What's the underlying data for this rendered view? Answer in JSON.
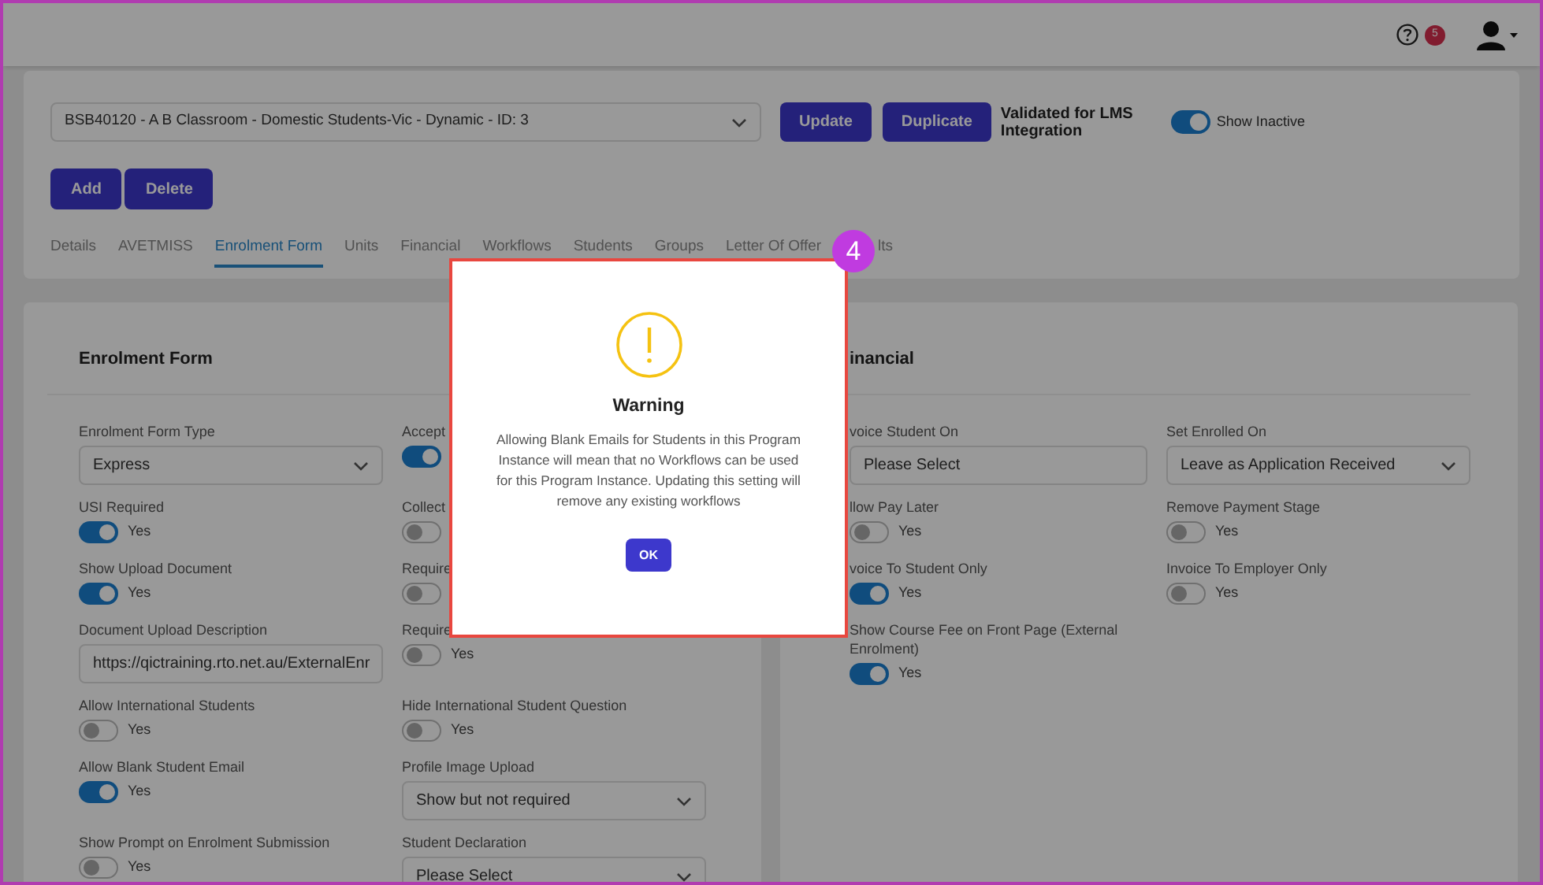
{
  "top_bar": {
    "notification_count": "5"
  },
  "program": {
    "selection": "BSB40120 - A B Classroom - Domestic Students-Vic - Dynamic - ID: 3",
    "buttons": [
      "Update",
      "Duplicate"
    ],
    "validation_note": "Validated for LMS Integration",
    "show_inactive": {
      "label": "Show Inactive",
      "on": true
    }
  },
  "actions": [
    "Add",
    "Delete"
  ],
  "tabs": [
    {
      "label": "Details",
      "selected": false
    },
    {
      "label": "AVETMISS",
      "selected": false
    },
    {
      "label": "Enrolment Form",
      "selected": true
    },
    {
      "label": "Units",
      "selected": false
    },
    {
      "label": "Financial",
      "selected": false
    },
    {
      "label": "Workflows",
      "selected": false
    },
    {
      "label": "Students",
      "selected": false
    },
    {
      "label": "Groups",
      "selected": false
    },
    {
      "label": "Letter Of Offer",
      "selected": false
    },
    {
      "label": "lts",
      "selected": false
    }
  ],
  "callout": "4",
  "enrolment_form": {
    "title": "Enrolment Form",
    "fields": [
      {
        "kind": "select",
        "label": "Enrolment Form Type",
        "value": "Express"
      },
      {
        "kind": "toggle",
        "label": "Accept",
        "on": true
      },
      {
        "kind": "toggle",
        "label": "USI Required",
        "on": true,
        "option_label": "Yes"
      },
      {
        "kind": "toggle",
        "label": "Collect",
        "on": false
      },
      {
        "kind": "toggle",
        "label": "Show Upload Document",
        "on": true,
        "option_label": "Yes"
      },
      {
        "kind": "toggle",
        "label": "Require",
        "on": false
      },
      {
        "kind": "text",
        "label": "Document Upload Description",
        "value": "https://qictraining.rto.net.au/ExternalEnr"
      },
      {
        "kind": "toggle",
        "label": "Require",
        "on": false,
        "option_label": "Yes"
      },
      {
        "kind": "toggle",
        "label": "Allow International Students",
        "on": false,
        "option_label": "Yes"
      },
      {
        "kind": "toggle",
        "label": "Hide International Student Question",
        "on": false,
        "option_label": "Yes"
      },
      {
        "kind": "toggle",
        "label": "Allow Blank Student Email",
        "on": true,
        "option_label": "Yes"
      },
      {
        "kind": "select",
        "label": "Profile Image Upload",
        "value": "Show but not required"
      },
      {
        "kind": "toggle",
        "label": "Show Prompt on Enrolment Submission",
        "on": false,
        "option_label": "Yes"
      },
      {
        "kind": "select",
        "label": "Student Declaration",
        "value": "Please Select"
      }
    ]
  },
  "financial": {
    "title": "inancial",
    "fields": [
      {
        "kind": "text",
        "label": "voice Student On",
        "value": "Please Select"
      },
      {
        "kind": "select",
        "label": "Set Enrolled On",
        "value": "Leave as Application Received"
      },
      {
        "kind": "toggle",
        "label": "llow Pay Later",
        "on": false,
        "option_label": "Yes"
      },
      {
        "kind": "toggle",
        "label": "Remove Payment Stage",
        "on": false,
        "option_label": "Yes"
      },
      {
        "kind": "toggle",
        "label": "voice To Student Only",
        "on": true,
        "option_label": "Yes"
      },
      {
        "kind": "toggle",
        "label": "Invoice To Employer Only",
        "on": false,
        "option_label": "Yes"
      },
      {
        "kind": "toggle",
        "label": "Show Course Fee on Front Page (External Enrolment)",
        "on": true,
        "option_label": "Yes"
      }
    ]
  },
  "dialog": {
    "title": "Warning",
    "message": "Allowing Blank Emails for Students in this Program Instance will mean that no Workflows can be used for this Program Instance. Updating this setting will remove any existing workflows",
    "button": "OK"
  }
}
